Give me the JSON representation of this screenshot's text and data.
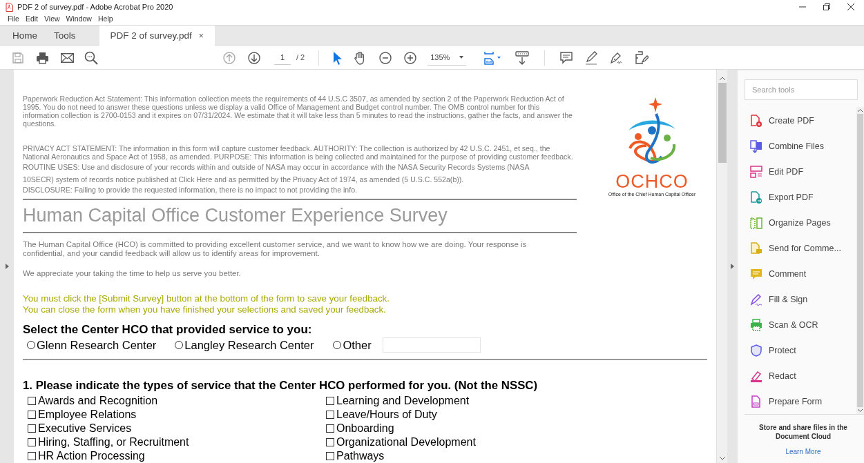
{
  "window": {
    "title": "PDF 2 of survey.pdf - Adobe Acrobat Pro 2020"
  },
  "menu": [
    "File",
    "Edit",
    "View",
    "Window",
    "Help"
  ],
  "tabs": [
    {
      "label": "Home",
      "selected": false,
      "kind": "nav"
    },
    {
      "label": "Tools",
      "selected": false,
      "kind": "nav"
    },
    {
      "label": "PDF 2 of survey.pdf",
      "selected": true,
      "kind": "document",
      "close": "×"
    }
  ],
  "toolbar": {
    "page": "1",
    "page_total": "/ 2",
    "zoom": "135%",
    "tools": [
      {
        "kind": "select",
        "selected": true
      },
      {
        "kind": "hand",
        "selected": false
      }
    ]
  },
  "document": {
    "notices": [
      "Paperwork Reduction Act Statement: This information collection meets the requirements of 44 U.S.C 3507, as amended by section 2 of the Paperwork Reduction Act of 1995. You do not need to answer these questions unless we display a valid Office of Management and Budget control number. The OMB control number for this information collection is 2700-0153 and it expires on 07/31/2024. We estimate that it will take less than 5 minutes to read the instructions, gather the facts, and answer the questions."
    ],
    "privacy": [
      "PRIVACY ACT STATEMENT: The information in this form will capture customer feedback. AUTHORITY: The collection is authorized by 42 U.S.C. 2451, et seq., the National Aeronautics and Space Act of 1958, as amended. PURPOSE: This information is being collected and maintained for the purpose of providing customer feedback.",
      "ROUTINE USES: Use and disclosure of your records within and outside of NASA may occur in accordance with the NASA Security Records Systems (NASA",
      "10SECR) system of records notice published at Click Here  and as permitted by the Privacy Act of 1974, as amended (5 U.S.C. 552a(b)).",
      "DISCLOSURE: Failing to provide the requested information, there is no impact to not providing the info."
    ],
    "logo": {
      "name": "OCHCO",
      "caption": "Office of the Chief Human Capital Officer"
    },
    "title": "Human Capital Office Customer Experience Survey",
    "intro": [
      "The Human Capital Office (HCO) is committed to providing excellent customer service, and we want to know how we are doing. Your response is confidential, and your candid feedback will allow us to identify areas for improvement.",
      "We appreciate your taking the time to help us serve you better."
    ],
    "instructions": [
      "You must click the [Submit Survey] button at the bottom of the form to save your feedback.",
      "You can close the form when you have finished your selections and saved your feedback."
    ],
    "center_question": {
      "label": "Select the Center HCO that provided service to you:",
      "options": [
        {
          "label": "Glenn Research Center",
          "selected": false
        },
        {
          "label": "Langley Research Center",
          "selected": false
        },
        {
          "label": "Other",
          "selected": false
        }
      ]
    },
    "question_1": {
      "label": "1. Please indicate the types of service that the Center HCO performed for you. (Not the NSSC)",
      "options": [
        {
          "label": "Awards and Recognition",
          "checked": false
        },
        {
          "label": "Employee Relations",
          "checked": false
        },
        {
          "label": "Executive Services",
          "checked": false
        },
        {
          "label": "Hiring, Staffing, or Recruitment",
          "checked": false
        },
        {
          "label": "HR Action Processing",
          "checked": false
        },
        {
          "label": "Learning and Development",
          "checked": false
        },
        {
          "label": "Leave/Hours of Duty",
          "checked": false
        },
        {
          "label": "Onboarding",
          "checked": false
        },
        {
          "label": "Organizational Development",
          "checked": false
        },
        {
          "label": "Pathways",
          "checked": false
        }
      ]
    }
  },
  "tools_panel": {
    "search": {
      "placeholder": "Search tools"
    },
    "tools": [
      {
        "label": "Create PDF",
        "kind": "create"
      },
      {
        "label": "Combine Files",
        "kind": "combine"
      },
      {
        "label": "Edit PDF",
        "kind": "edit"
      },
      {
        "label": "Export PDF",
        "kind": "export"
      },
      {
        "label": "Organize Pages",
        "kind": "organize"
      },
      {
        "label": "Send for Comme...",
        "kind": "send"
      },
      {
        "label": "Comment",
        "kind": "comment"
      },
      {
        "label": "Fill & Sign",
        "kind": "sign"
      },
      {
        "label": "Scan & OCR",
        "kind": "scan"
      },
      {
        "label": "Protect",
        "kind": "protect"
      },
      {
        "label": "Redact",
        "kind": "redact"
      },
      {
        "label": "Prepare Form",
        "kind": "form"
      }
    ],
    "promo": "Store and share files in the Document Cloud",
    "link": "Learn More"
  }
}
